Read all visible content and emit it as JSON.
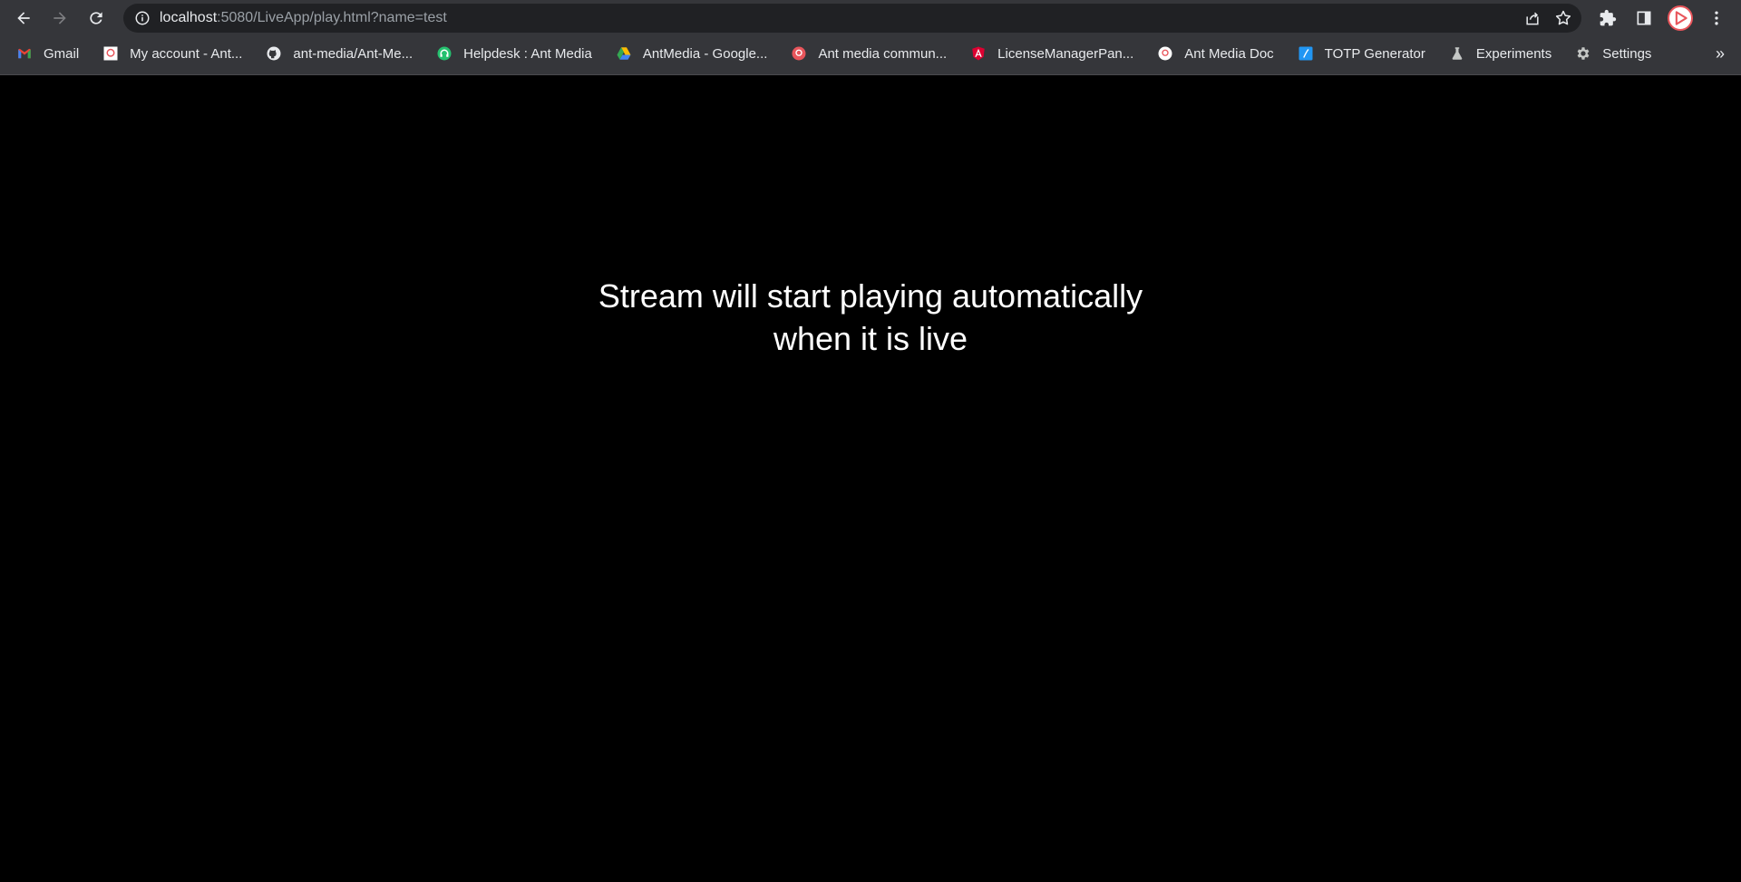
{
  "browser": {
    "url_host": "localhost",
    "url_rest": ":5080/LiveApp/play.html?name=test",
    "bookmarks": [
      {
        "label": "Gmail",
        "icon": "gmail-icon"
      },
      {
        "label": "My account - Ant...",
        "icon": "antmedia-logo-icon"
      },
      {
        "label": "ant-media/Ant-Me...",
        "icon": "github-icon"
      },
      {
        "label": "Helpdesk : Ant Media",
        "icon": "helpdesk-icon"
      },
      {
        "label": "AntMedia - Google...",
        "icon": "google-drive-icon"
      },
      {
        "label": "Ant media commun...",
        "icon": "antmedia-community-icon"
      },
      {
        "label": "LicenseManagerPan...",
        "icon": "angular-icon"
      },
      {
        "label": "Ant Media Doc",
        "icon": "antmedia-doc-icon"
      },
      {
        "label": "TOTP Generator",
        "icon": "totp-icon"
      },
      {
        "label": "Experiments",
        "icon": "flask-icon"
      },
      {
        "label": "Settings",
        "icon": "gear-icon"
      }
    ],
    "more_label": "»"
  },
  "page": {
    "message_line1": "Stream will start playing automatically",
    "message_line2": "when it is live"
  },
  "colors": {
    "chrome_bg": "#35363a",
    "omnibox_bg": "#202124",
    "page_bg": "#000000",
    "text": "#ffffff"
  }
}
